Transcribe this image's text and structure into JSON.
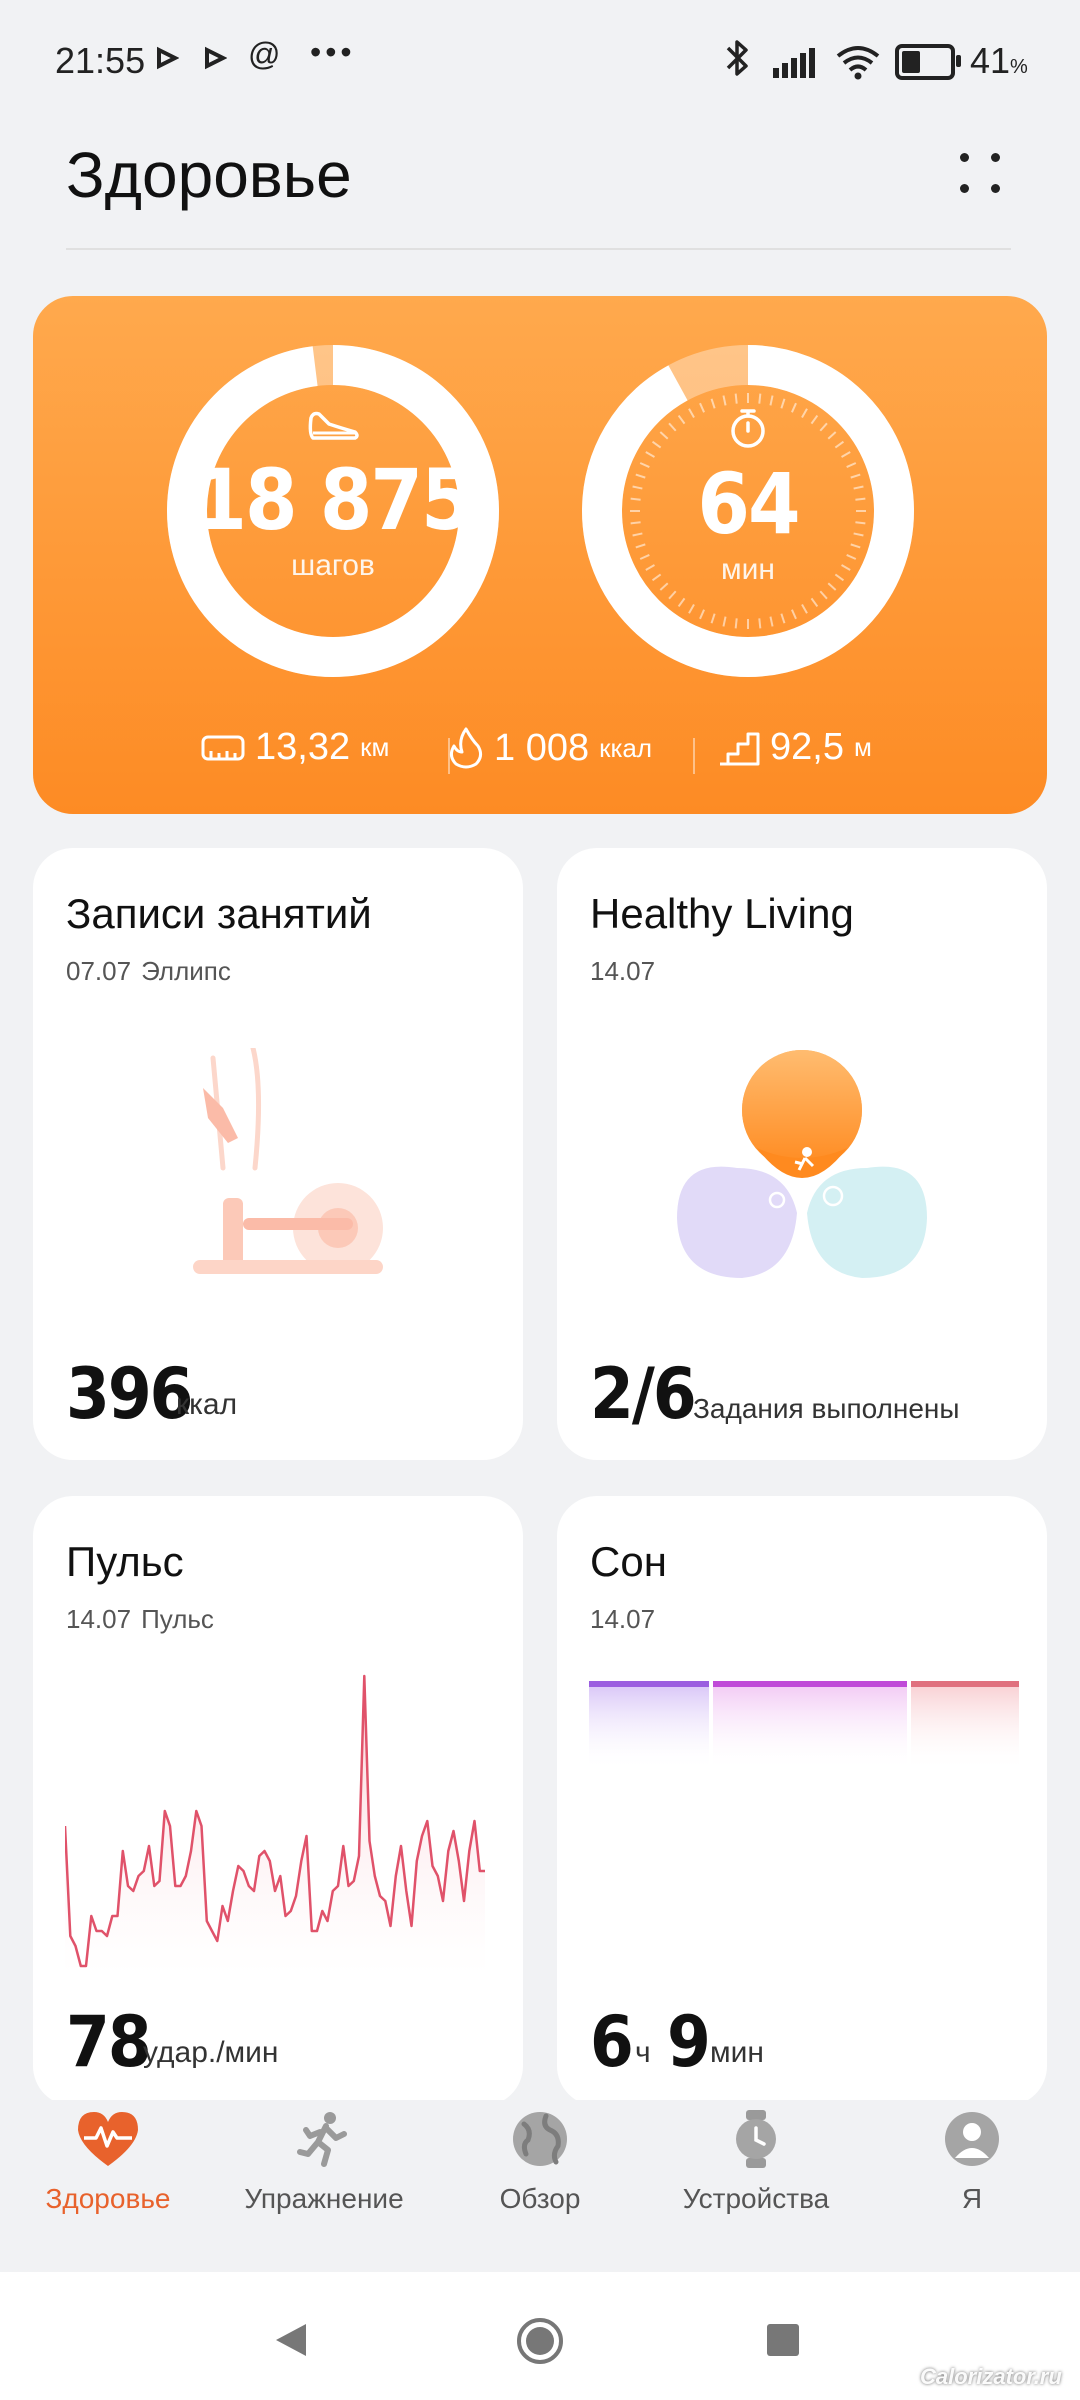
{
  "status_bar": {
    "time": "21:55",
    "battery": "41",
    "battery_unit": "%",
    "icons": [
      "play-icon",
      "play-icon",
      "at-icon",
      "more-icon",
      "bluetooth-icon",
      "signal-icon",
      "wifi-icon",
      "battery-icon"
    ]
  },
  "header": {
    "title": "Здоровье"
  },
  "activity": {
    "steps": {
      "value": "18 875",
      "unit": "шагов",
      "progress": 0.98
    },
    "active_minutes": {
      "value": "64",
      "unit": "мин",
      "progress": 0.92
    },
    "distance": {
      "value": "13,32",
      "unit": "км"
    },
    "calories": {
      "value": "1 008",
      "unit": "ккал"
    },
    "climb": {
      "value": "92,5",
      "unit": "м"
    },
    "accent": "#fd8b24"
  },
  "cards": {
    "workouts": {
      "title": "Записи занятий",
      "date": "07.07",
      "type": "Эллипс",
      "value": "396",
      "unit": "ккал"
    },
    "healthy_living": {
      "title": "Healthy Living",
      "date": "14.07",
      "value": "2/6",
      "unit": "Задания выполнены"
    },
    "pulse": {
      "title": "Пульс",
      "date": "14.07",
      "type": "Пульс",
      "value": "78",
      "unit": "удар./мин"
    },
    "sleep": {
      "title": "Сон",
      "date": "14.07",
      "hours": "6",
      "hours_unit": "ч",
      "minutes": "9",
      "minutes_unit": "мин"
    }
  },
  "bottom_nav": {
    "items": [
      {
        "label": "Здоровье",
        "icon": "heart-pulse-icon",
        "active": true
      },
      {
        "label": "Упражнение",
        "icon": "runner-icon",
        "active": false
      },
      {
        "label": "Обзор",
        "icon": "globe-icon",
        "active": false
      },
      {
        "label": "Устройства",
        "icon": "watch-icon",
        "active": false
      },
      {
        "label": "Я",
        "icon": "avatar-icon",
        "active": false
      }
    ],
    "active_color": "#e8622c"
  },
  "watermark": "Calorizator.ru"
}
